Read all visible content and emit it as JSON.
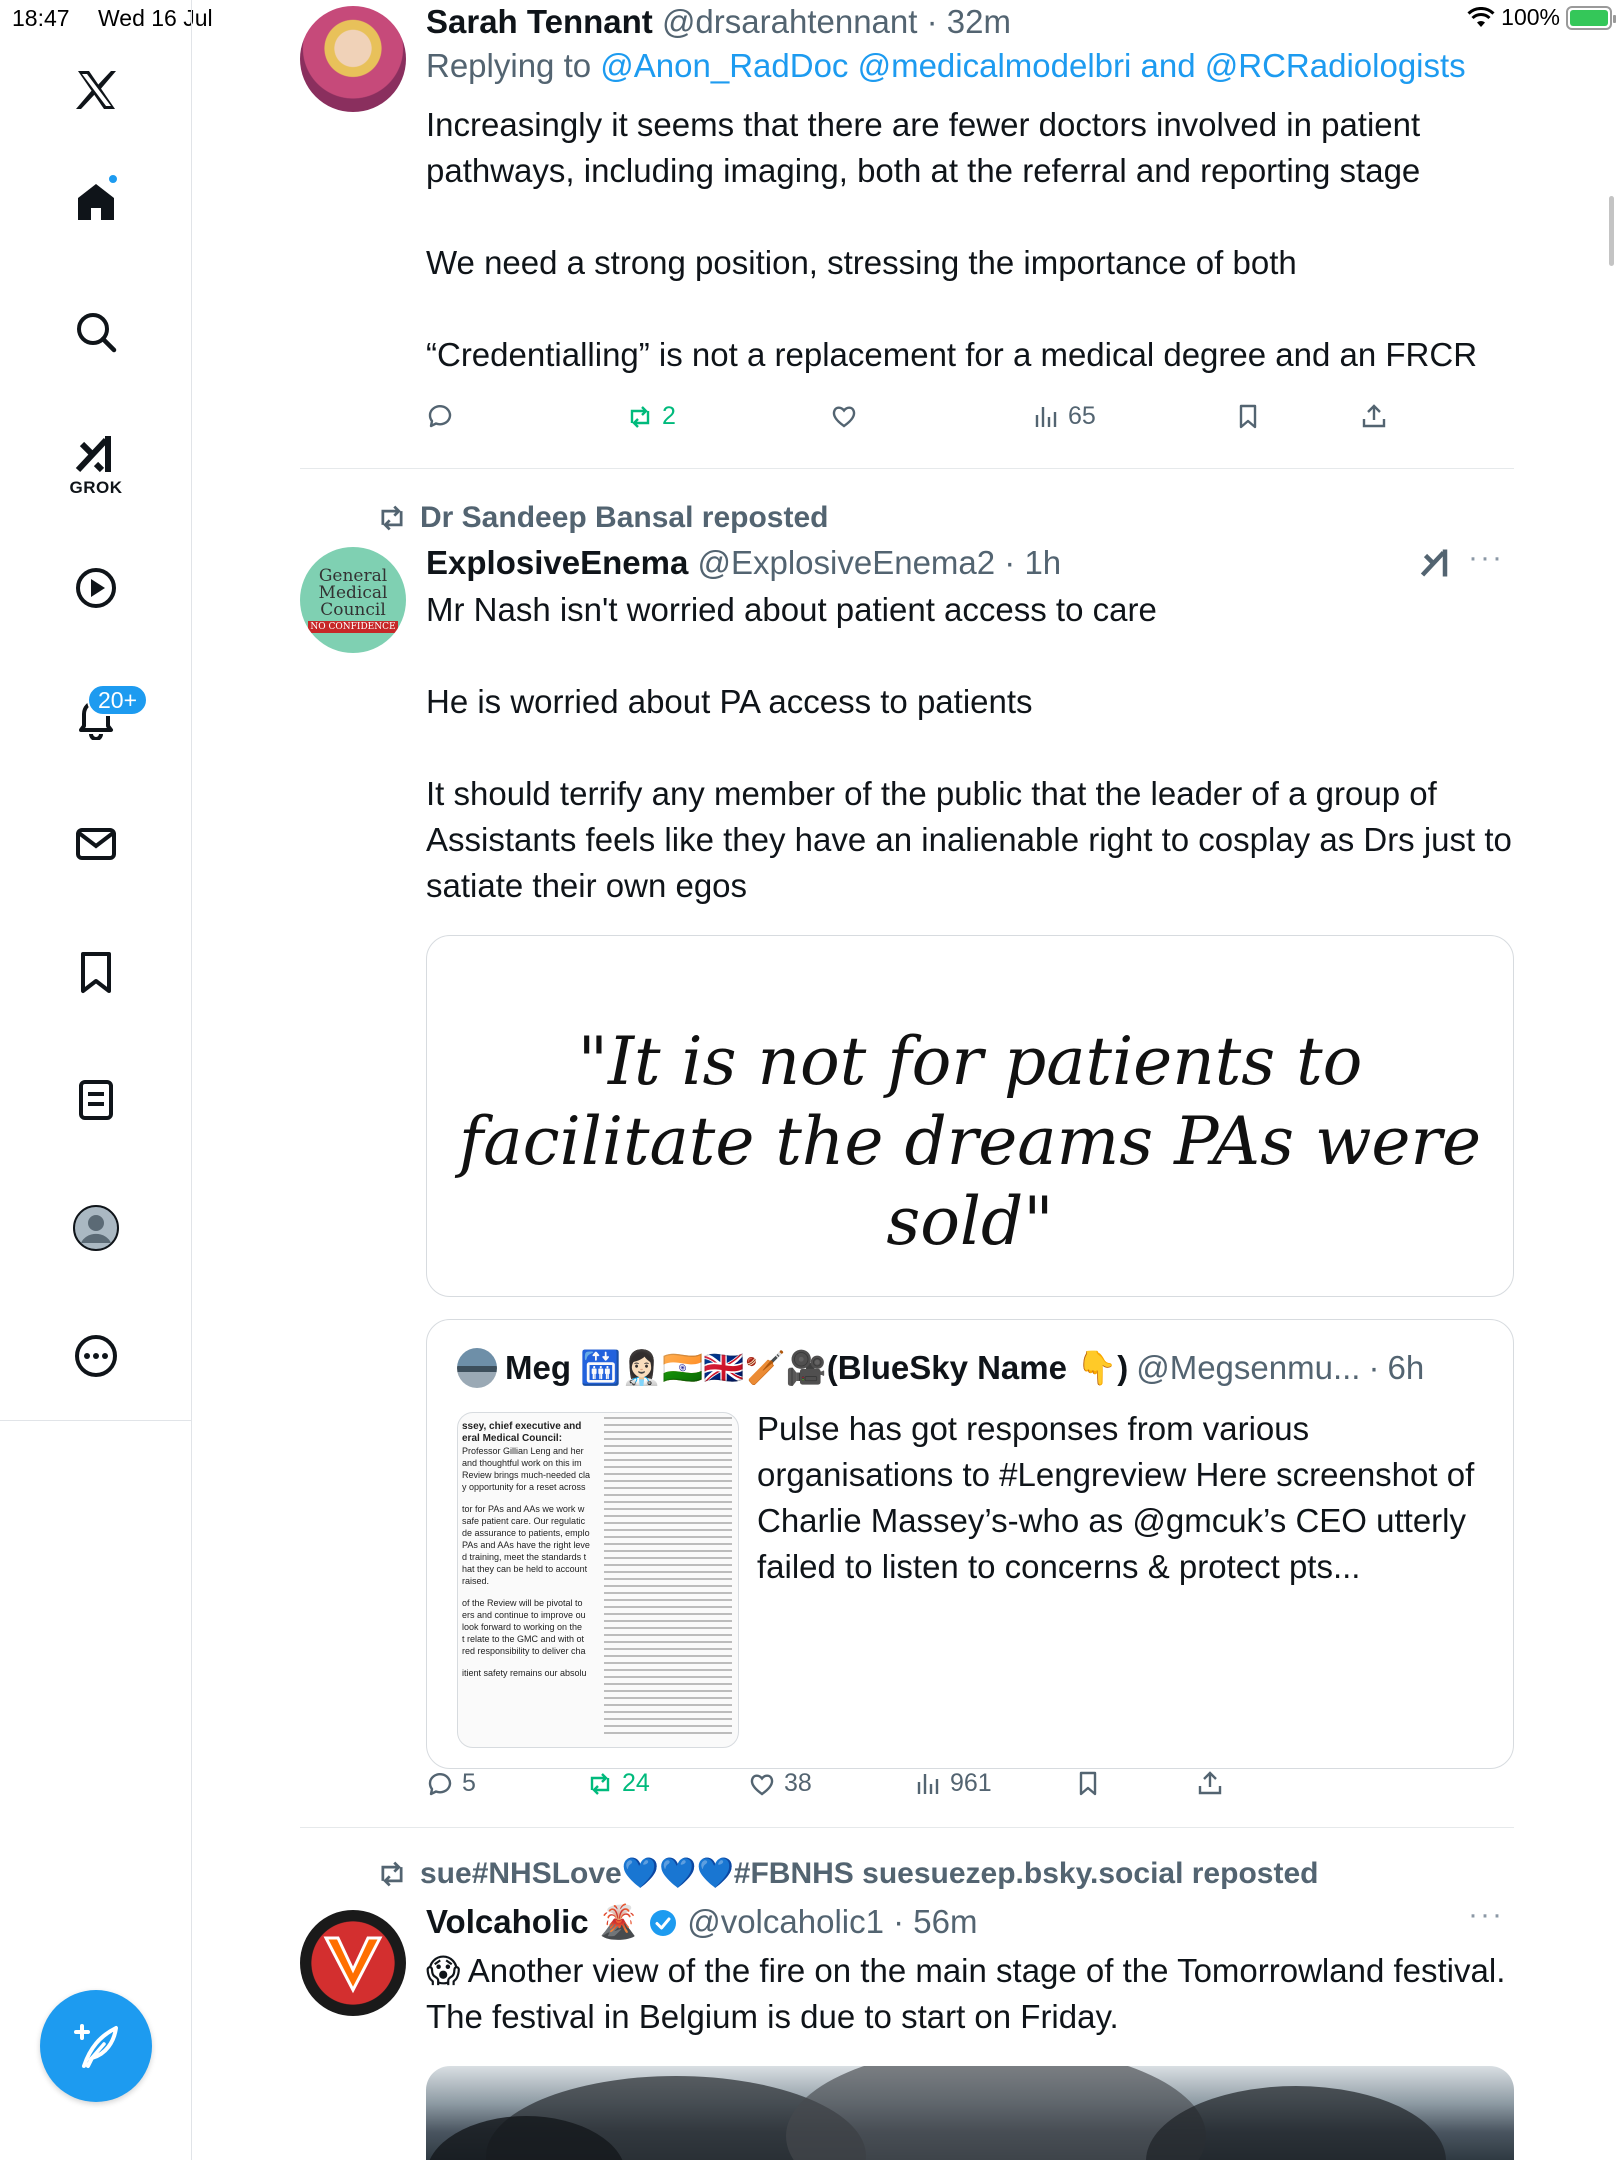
{
  "status_bar": {
    "time": "18:47",
    "date": "Wed 16 Jul",
    "battery": "100%"
  },
  "sidebar": {
    "grok_label": "GROK",
    "notifications_badge": "20+",
    "items": [
      "x-logo",
      "home",
      "search",
      "grok",
      "videos",
      "notifications",
      "messages",
      "bookmarks",
      "lists",
      "profile",
      "more"
    ]
  },
  "tweet1": {
    "display_name": "Sarah Tennant",
    "handle": "@drsarahtennant",
    "time": "32m",
    "replying_to_label": "Replying to",
    "replying_to": "@Anon_RadDoc @medicalmodelbri and @RCRadiologists",
    "text_p1": "Increasingly it seems that there are fewer doctors involved in patient pathways, including imaging, both at the referral and reporting stage",
    "text_p2": "We need a strong position, stressing the importance of both",
    "text_p3": "“Credentialling” is not a replacement for a medical degree and an FRCR",
    "reposts": "2",
    "views": "65"
  },
  "tweet2": {
    "reposted_by": "Dr Sandeep Bansal reposted",
    "avatar_text": [
      "General",
      "Medical",
      "Council"
    ],
    "avatar_banner": "NO CONFIDENCE",
    "display_name": "ExplosiveEnema",
    "handle": "@ExplosiveEnema2",
    "time": "1h",
    "text_p1": "Mr Nash isn't worried about patient access to care",
    "text_p2": "He is worried about PA access to patients",
    "text_p3": "It should terrify any member of the public that the leader of a group of Assistants feels like they have an inalienable right to cosplay as Drs just to satiate their own egos",
    "image_quote_line1": "\"It is not for patients to",
    "image_quote_line2": "facilitate the dreams PAs were sold\"",
    "quoted": {
      "display_name": "Meg 🛗👩🏻‍⚕️🇮🇳🇬🇧🏏🎥(BlueSky Name 👇)",
      "handle": "@Megsenmu...",
      "time": "6h",
      "text": "Pulse has got responses from various organisations to #Lengreview Here screenshot of Charlie Massey’s-who as @gmcuk’s CEO utterly failed to listen to concerns & protect pts...",
      "thumb_heading": "ssey, chief executive and eral Medical Council:",
      "thumb_left_lines": [
        "Professor Gillian Leng and her",
        "and thoughtful work on this im",
        "Review brings much-needed cla",
        "y opportunity for a reset across",
        "",
        "tor for PAs and AAs we work w",
        "safe patient care. Our regulatic",
        "de assurance to patients, emplo",
        "PAs and AAs have the right leve",
        "d training, meet the standards t",
        "hat they can be held to account",
        "raised.",
        "",
        "of the Review will be pivotal to",
        "ers and continue to improve ou",
        "look forward to working on the",
        "t relate to the GMC and with ot",
        "red responsibility to deliver cha",
        "",
        "itient safety remains our absolu"
      ]
    },
    "replies": "5",
    "reposts": "24",
    "likes": "38",
    "views": "961"
  },
  "tweet3": {
    "reposted_by": "sue#NHSLove💙💙💙#FBNHS suesuezep.bsky.social reposted",
    "display_name": "Volcaholic 🌋",
    "handle": "@volcaholic1",
    "time": "56m",
    "text": "😱 Another view of the fire on the main stage of the Tomorrowland festival.  The festival in Belgium is due to start on Friday."
  },
  "colors": {
    "accent": "#1d9bf0",
    "repost_green": "#00ba7c",
    "secondary_text": "#536471"
  }
}
